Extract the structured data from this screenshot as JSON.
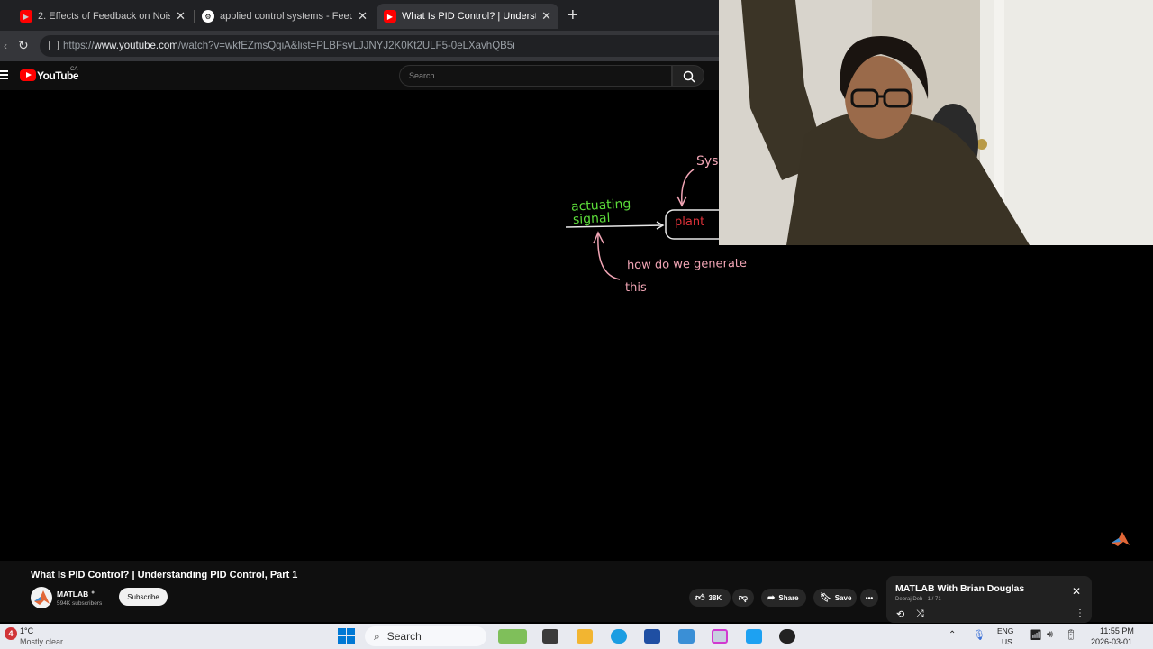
{
  "browser": {
    "tabs": [
      {
        "title": "2. Effects of Feedback on Noise an",
        "favicon": "youtube",
        "active": false
      },
      {
        "title": "applied control systems - Feedbac",
        "favicon": "chatgpt",
        "active": false
      },
      {
        "title": "What Is PID Control? | Understand",
        "favicon": "youtube",
        "active": true
      }
    ],
    "new_tab_glyph": "+",
    "url_prefix": "https://",
    "url_domain": "www.youtube.com",
    "url_path": "/watch?v=wkfEZmsQqiA&list=PLBFsvLJJNYJ2K0Kt2ULF5-0eLXavhQB5i"
  },
  "youtube": {
    "logo_text": "YouTube",
    "region": "CA",
    "search_placeholder": "Search"
  },
  "video": {
    "handwriting": {
      "actuating": "actuating",
      "signal": "signal",
      "plant": "plant",
      "sys": "Sys",
      "question_line1": "how do we generate",
      "question_line2": "this"
    },
    "title": "What Is PID Control? | Understanding PID Control, Part 1",
    "channel": "MATLAB",
    "subscribers": "594K subscribers",
    "subscribe_label": "Subscribe",
    "likes": "38K",
    "share_label": "Share",
    "save_label": "Save"
  },
  "playlist": {
    "title": "MATLAB With Brian Douglas",
    "subtitle": "Debraj Deb - 1 / 71"
  },
  "taskbar": {
    "badge": "4",
    "temperature": "1°C",
    "weather": "Mostly clear",
    "search_label": "Search",
    "lang_top": "ENG",
    "lang_bottom": "US",
    "time": "11:55 PM",
    "date": "2026-03-01"
  },
  "colors": {
    "youtube_red": "#ff0000",
    "chalk_green": "#5dde3a",
    "chalk_pink": "#f0a4b4",
    "plant_red": "#e0323a"
  }
}
